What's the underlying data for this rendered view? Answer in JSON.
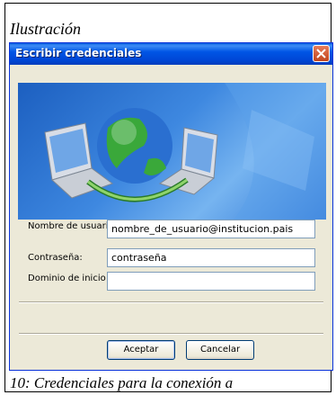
{
  "document": {
    "caption_top": "Ilustración",
    "caption_bottom": "10: Credenciales para la conexión a"
  },
  "dialog": {
    "title": "Escribir credenciales",
    "close_icon": "close-icon",
    "banner_icon": "network-globe-laptops-icon",
    "fields": {
      "username_label": "Nombre de usuario:",
      "username_value": "nombre_de_usuario@institucion.pais",
      "password_label": "Contraseña:",
      "password_value": "contraseña",
      "domain_label": "Dominio de inicio de sesión:",
      "domain_value": ""
    },
    "buttons": {
      "ok": "Aceptar",
      "cancel": "Cancelar"
    }
  },
  "colors": {
    "titlebar": "#0055e5",
    "dialog_bg": "#ece9d8",
    "banner": "#3e88e0",
    "close_button": "#c2461e"
  }
}
